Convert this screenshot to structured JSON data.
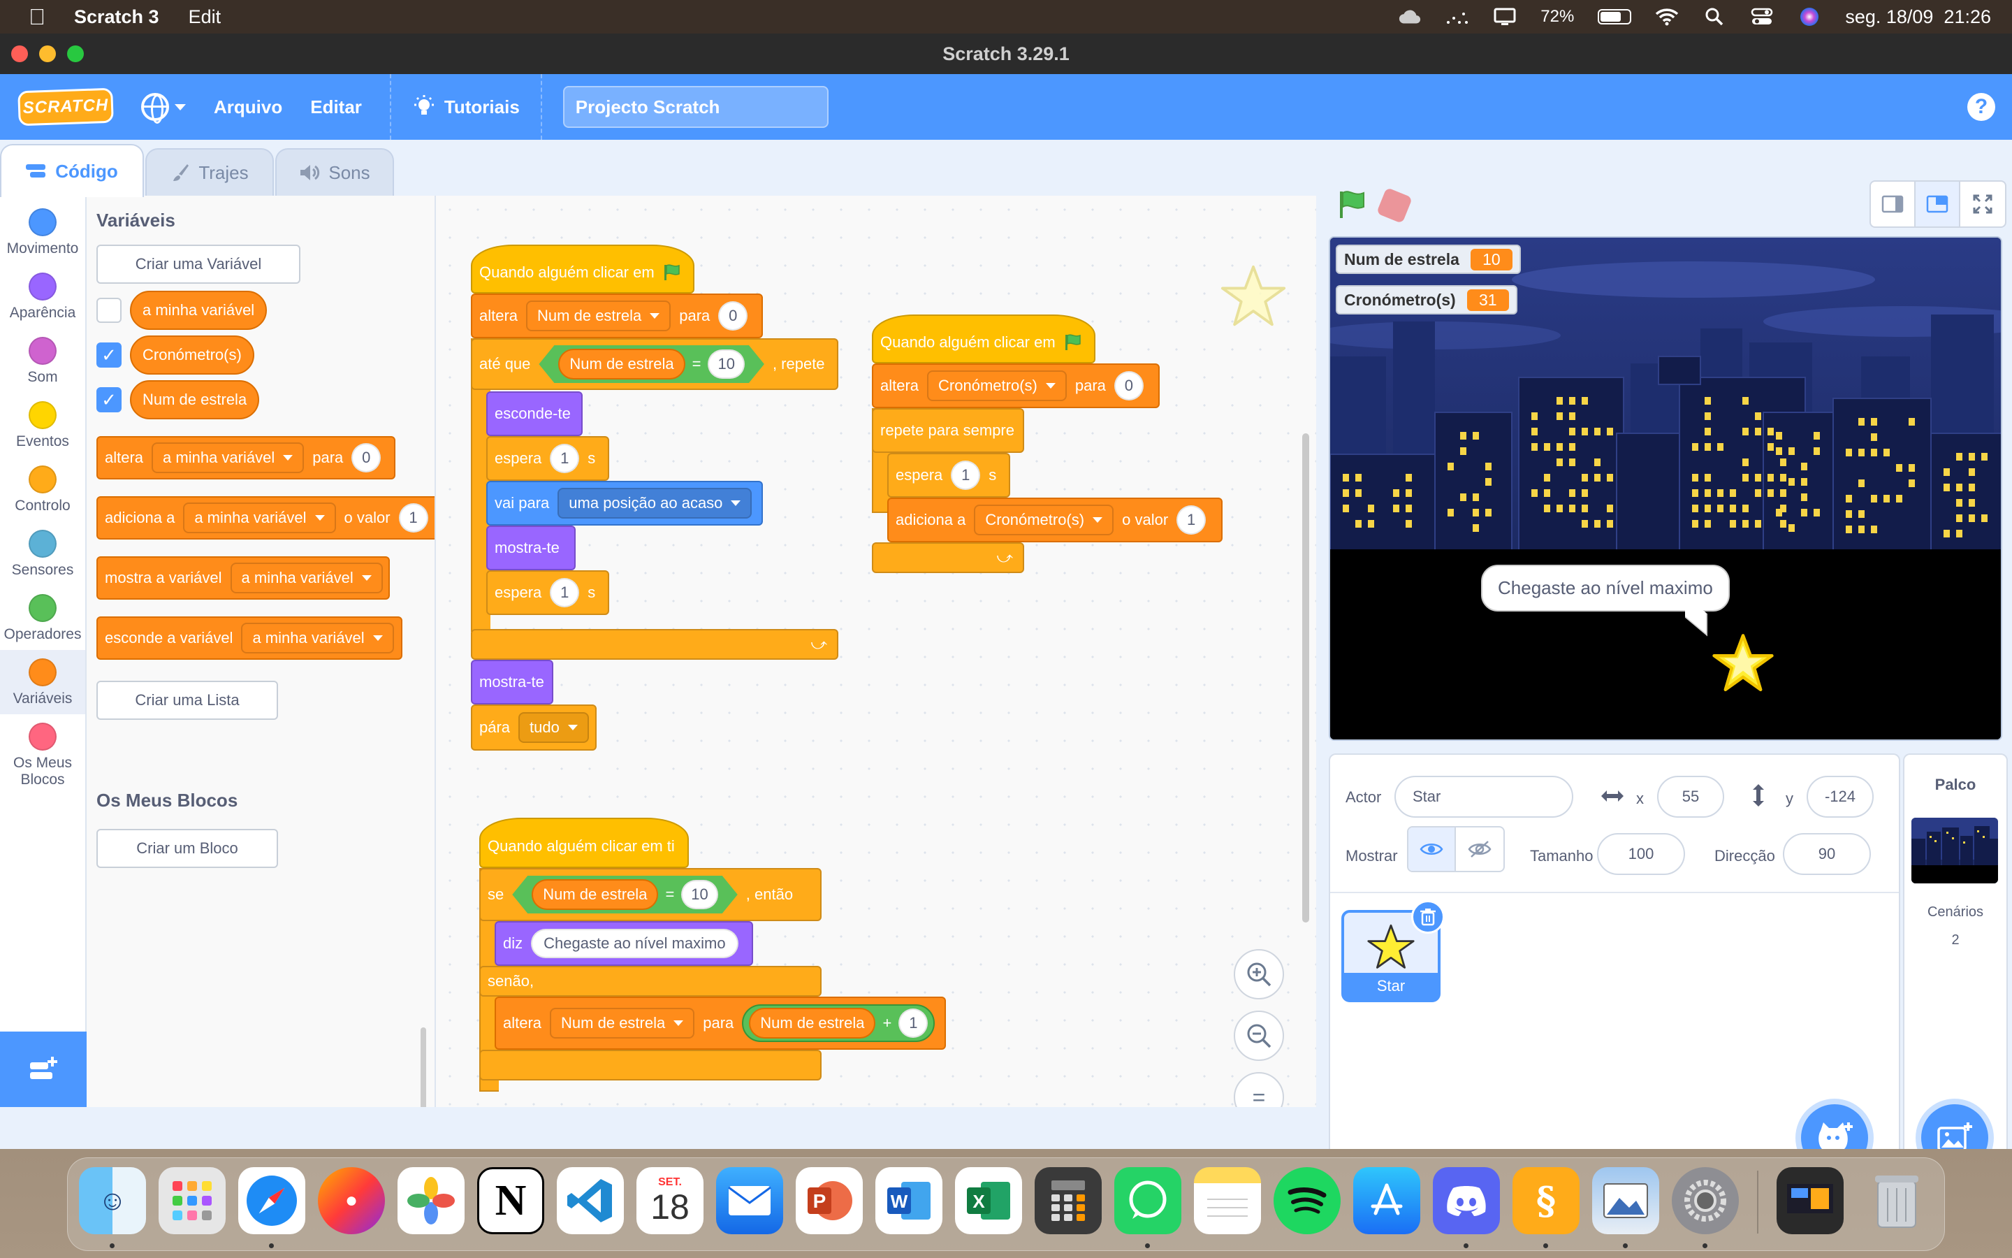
{
  "menubar": {
    "app_name": "Scratch 3",
    "menu_items": [
      "Edit"
    ],
    "battery": "72%",
    "datetime": "seg. 18/09  21:26"
  },
  "window": {
    "title": "Scratch 3.29.1"
  },
  "scratch_menu": {
    "logo": "SCRATCH",
    "file": "Arquivo",
    "edit": "Editar",
    "tutorials": "Tutoriais",
    "project_title": "Projecto Scratch",
    "help": "?"
  },
  "tabs": {
    "code": "Código",
    "costumes": "Trajes",
    "sounds": "Sons"
  },
  "categories": [
    {
      "label": "Movimento",
      "color": "#4c97ff"
    },
    {
      "label": "Aparência",
      "color": "#9966ff"
    },
    {
      "label": "Som",
      "color": "#cf63cf"
    },
    {
      "label": "Eventos",
      "color": "#ffd500"
    },
    {
      "label": "Controlo",
      "color": "#ffab19"
    },
    {
      "label": "Sensores",
      "color": "#5cb1d6"
    },
    {
      "label": "Operadores",
      "color": "#59c059"
    },
    {
      "label": "Variáveis",
      "color": "#ff8c1a"
    },
    {
      "label": "Os Meus Blocos",
      "color": "#ff6680"
    }
  ],
  "palette": {
    "heading": "Variáveis",
    "make_variable": "Criar uma Variável",
    "variables": [
      {
        "name": "a minha variável",
        "checked": false
      },
      {
        "name": "Cronómetro(s)",
        "checked": true
      },
      {
        "name": "Num de estrela",
        "checked": true
      }
    ],
    "set_block": {
      "label": "altera",
      "var": "a minha variável",
      "to": "para",
      "value": "0"
    },
    "change_block": {
      "label": "adiciona a",
      "var": "a minha variável",
      "by": "o valor",
      "value": "1"
    },
    "show_block": {
      "label": "mostra a variável",
      "var": "a minha variável"
    },
    "hide_block": {
      "label": "esconde a variável",
      "var": "a minha variável"
    },
    "make_list": "Criar uma Lista",
    "my_blocks_heading": "Os Meus Blocos",
    "make_block": "Criar um Bloco"
  },
  "script1": {
    "hat": "Quando alguém clicar em",
    "set_label": "altera",
    "set_var": "Num de estrela",
    "set_to": "para",
    "set_value": "0",
    "until_label": "até que",
    "until_var": "Num de estrela",
    "until_op": "=",
    "until_value": "10",
    "repeat_label": ", repete",
    "hide": "esconde-te",
    "wait1_label": "espera",
    "wait1_value": "1",
    "wait1_unit": "s",
    "goto_label": "vai para",
    "goto_target": "uma posição ao acaso",
    "show": "mostra-te",
    "wait2_label": "espera",
    "wait2_value": "1",
    "wait2_unit": "s",
    "show2": "mostra-te",
    "stop_label": "pára",
    "stop_value": "tudo"
  },
  "script2": {
    "hat": "Quando alguém clicar em",
    "set_label": "altera",
    "set_var": "Cronómetro(s)",
    "set_to": "para",
    "set_value": "0",
    "forever": "repete para sempre",
    "wait_label": "espera",
    "wait_value": "1",
    "wait_unit": "s",
    "change_label": "adiciona a",
    "change_var": "Cronómetro(s)",
    "change_by": "o valor",
    "change_value": "1"
  },
  "script3": {
    "hat": "Quando alguém clicar em ti",
    "if_label": "se",
    "if_var": "Num de estrela",
    "if_op": "=",
    "if_value": "10",
    "then_label": ", então",
    "say_label": "diz",
    "say_text": "Chegaste ao nível maximo",
    "else_label": "senão,",
    "set_label": "altera",
    "set_var": "Num de estrela",
    "set_to": "para",
    "set_expr_var": "Num de estrela",
    "set_expr_op": "+",
    "set_expr_value": "1"
  },
  "zoom": {
    "in": "+",
    "out": "−",
    "reset": "="
  },
  "stage": {
    "monitors": [
      {
        "label": "Num de estrela",
        "value": "10"
      },
      {
        "label": "Cronómetro(s)",
        "value": "31"
      }
    ],
    "speech": "Chegaste ao nível maximo"
  },
  "sprite_info": {
    "sprite_label": "Actor",
    "sprite_name": "Star",
    "x_label": "x",
    "x": "55",
    "y_label": "y",
    "y": "-124",
    "show_label": "Mostrar",
    "size_label": "Tamanho",
    "size": "100",
    "direction_label": "Direcção",
    "direction": "90"
  },
  "sprites": [
    {
      "name": "Star"
    }
  ],
  "stage_pane": {
    "title": "Palco",
    "backdrops_label": "Cenários",
    "backdrops_count": "2"
  },
  "dock": {
    "calendar_month": "SET.",
    "calendar_day": "18",
    "apps": [
      "finder-icon",
      "launchpad-icon",
      "safari-icon",
      "firefox-icon",
      "photos-icon",
      "notion-icon",
      "vscode-icon",
      "calendar-icon",
      "mail-icon",
      "powerpoint-icon",
      "word-icon",
      "excel-icon",
      "calculator-icon",
      "whatsapp-icon",
      "notes-icon",
      "spotify-icon",
      "appstore-icon",
      "discord-icon",
      "scratch-icon",
      "preview-icon",
      "settings-icon",
      "screenshot-icon",
      "trash-icon"
    ]
  }
}
